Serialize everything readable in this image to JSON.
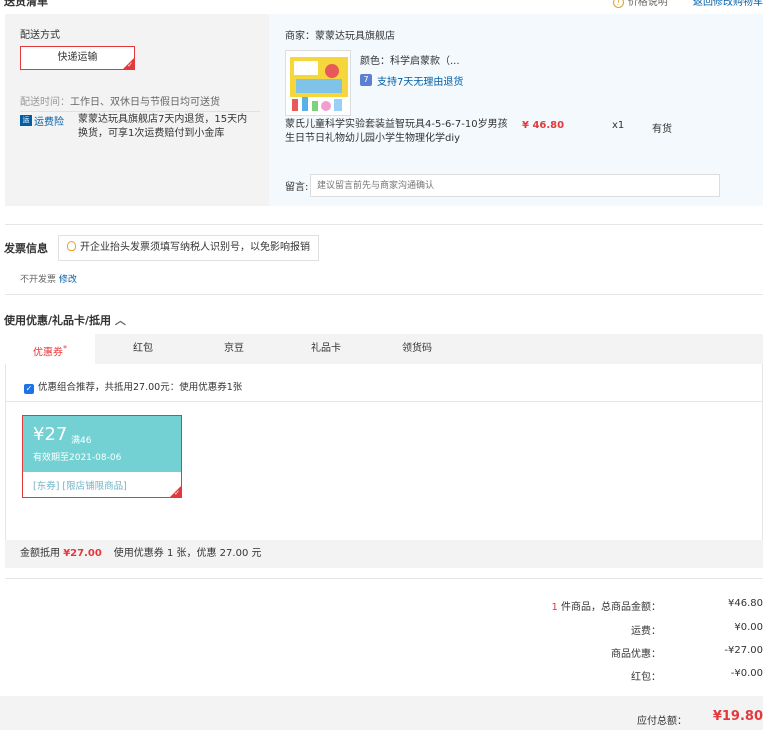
{
  "header": {
    "section_title": "送货清单",
    "price_desc_link": "价格说明",
    "back_cart_link": "返回修改购物车"
  },
  "shipping": {
    "label": "配送方式",
    "method": "快递运输",
    "time_label": "配送时间：",
    "time_value": "工作日、双休日与节假日均可送货",
    "insurance_icon": "运",
    "insurance_link": "运费险",
    "insurance_desc": "蒙蒙达玩具旗舰店7天内退货，15天内换货，可享1次运费赔付到小金库"
  },
  "product": {
    "shop": "商家：蒙蒙达玩具旗舰店",
    "image_icon": "product-image",
    "color": "颜色：科学启蒙款（...",
    "return_icon": "7",
    "return_policy": "支持7天无理由退货",
    "name": "蒙氏儿童科学实验套装益智玩具4-5-6-7-10岁男孩生日节日礼物幼儿园小学生物理化学diy",
    "price": "¥ 46.80",
    "qty": "x1",
    "stock": "有货",
    "memo_label": "留言:",
    "memo_placeholder": "建议留言前先与商家沟通确认"
  },
  "invoice": {
    "title": "发票信息",
    "tip": "开企业抬头发票须填写纳税人识别号，以免影响报销",
    "value": "不开发票",
    "edit": "修改"
  },
  "coupon": {
    "title": "使用优惠/礼品卡/抵用",
    "tabs": [
      {
        "label": "优惠券",
        "badge": "*"
      },
      {
        "label": "红包"
      },
      {
        "label": "京豆"
      },
      {
        "label": "礼品卡"
      },
      {
        "label": "领货码"
      }
    ],
    "recommend": "优惠组合推荐，共抵用27.00元：使用优惠券1张",
    "card": {
      "amount": "¥27",
      "condition": "满46",
      "expiry": "有效期至2021-08-06",
      "tags": "[东券] [限店铺限商品]"
    },
    "summary_label": "金额抵用",
    "summary_amount": "¥27.00",
    "summary_desc": "使用优惠券 1 张，优惠 27.00 元"
  },
  "totals": {
    "count": "1",
    "items_label": "件商品，总商品金额：",
    "items_value": "¥46.80",
    "shipping_label": "运费：",
    "shipping_value": "¥0.00",
    "discount_label": "商品优惠：",
    "discount_value": "-¥27.00",
    "redpacket_label": "红包：",
    "redpacket_value": "-¥0.00",
    "payable_label": "应付总额：",
    "payable_value": "¥19.80"
  },
  "colors": {
    "accent": "#e4393c",
    "link": "#005ea7",
    "coupon": "#73d1d3"
  }
}
